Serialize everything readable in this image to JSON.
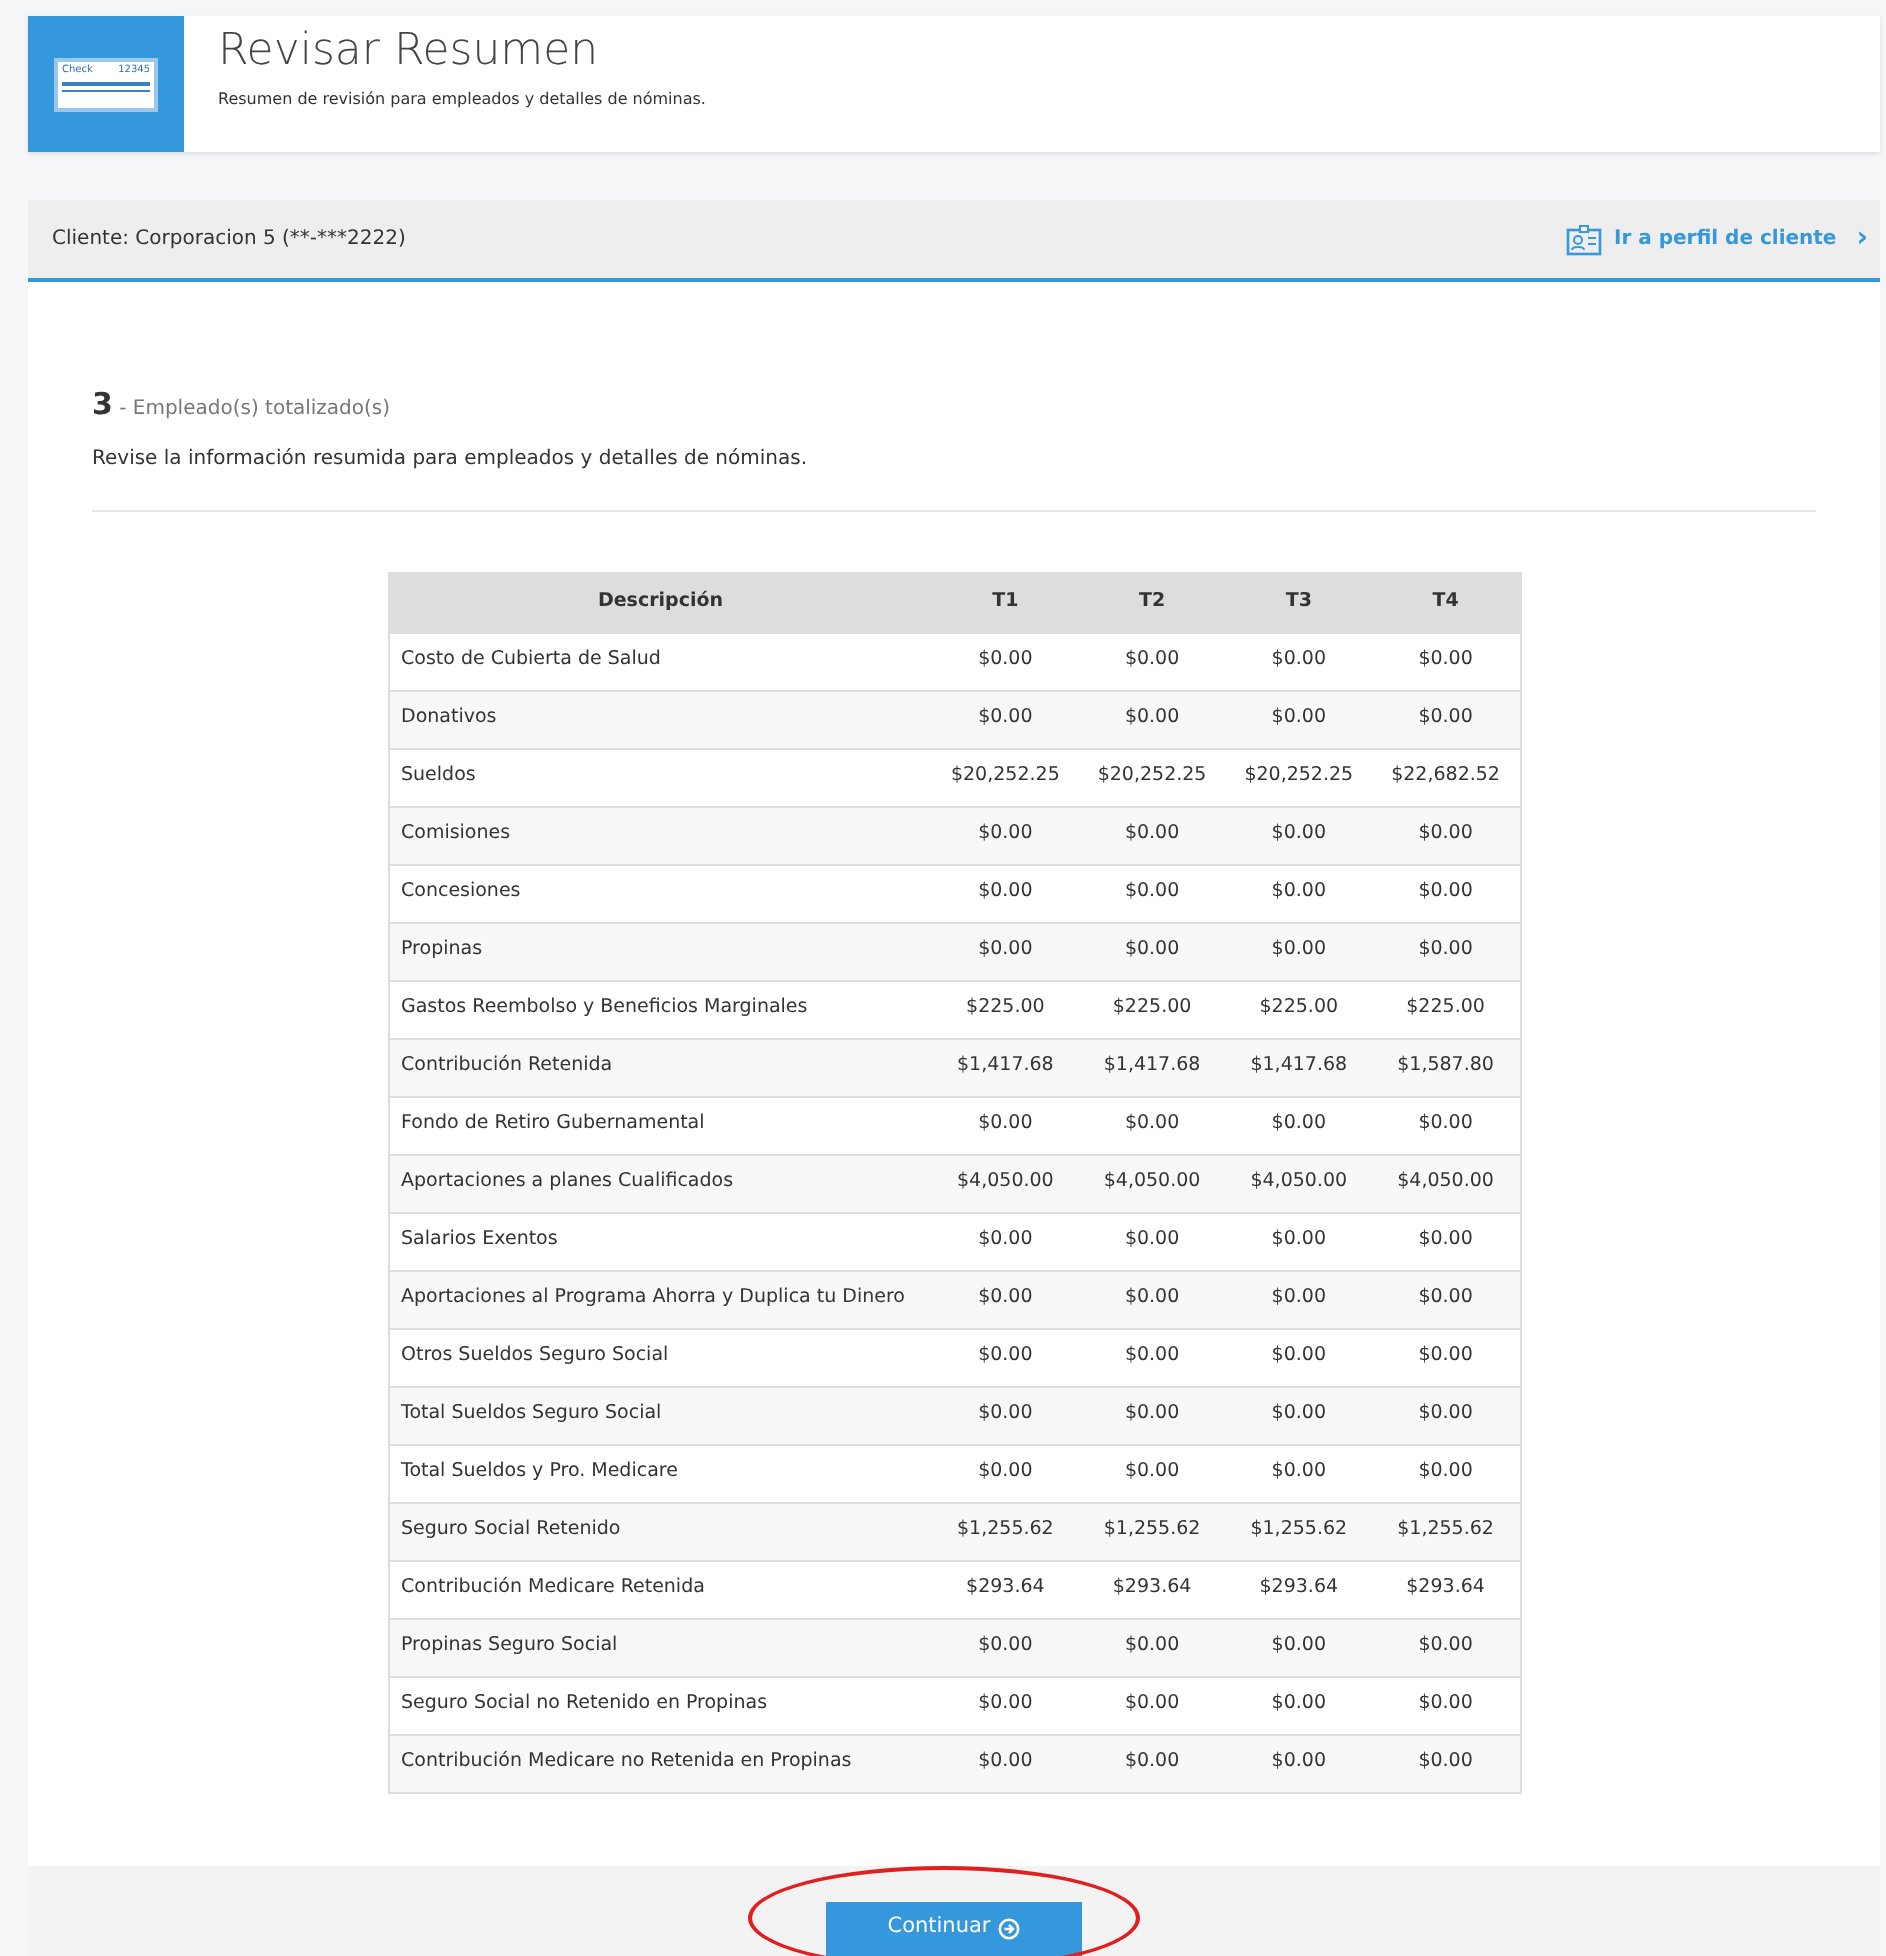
{
  "header": {
    "icon_text": [
      "Check",
      "12345"
    ],
    "title": "Revisar Resumen",
    "subtitle": "Resumen de revisión para empleados y detalles de nóminas."
  },
  "client_bar": {
    "client": "Cliente: Corporacion 5 (**-***2222)",
    "link": "Ir a perfil de cliente",
    "chevron": "›"
  },
  "summary": {
    "count": "3",
    "count_label": "- Empleado(s) totalizado(s)",
    "description": "Revise la información resumida para empleados y detalles de nóminas."
  },
  "table": {
    "columns": [
      "Descripción",
      "T1",
      "T2",
      "T3",
      "T4"
    ],
    "rows": [
      [
        "Costo de Cubierta de Salud",
        "$0.00",
        "$0.00",
        "$0.00",
        "$0.00"
      ],
      [
        "Donativos",
        "$0.00",
        "$0.00",
        "$0.00",
        "$0.00"
      ],
      [
        "Sueldos",
        "$20,252.25",
        "$20,252.25",
        "$20,252.25",
        "$22,682.52"
      ],
      [
        "Comisiones",
        "$0.00",
        "$0.00",
        "$0.00",
        "$0.00"
      ],
      [
        "Concesiones",
        "$0.00",
        "$0.00",
        "$0.00",
        "$0.00"
      ],
      [
        "Propinas",
        "$0.00",
        "$0.00",
        "$0.00",
        "$0.00"
      ],
      [
        "Gastos Reembolso y Beneficios Marginales",
        "$225.00",
        "$225.00",
        "$225.00",
        "$225.00"
      ],
      [
        "Contribución Retenida",
        "$1,417.68",
        "$1,417.68",
        "$1,417.68",
        "$1,587.80"
      ],
      [
        "Fondo de Retiro Gubernamental",
        "$0.00",
        "$0.00",
        "$0.00",
        "$0.00"
      ],
      [
        "Aportaciones a planes Cualificados",
        "$4,050.00",
        "$4,050.00",
        "$4,050.00",
        "$4,050.00"
      ],
      [
        "Salarios Exentos",
        "$0.00",
        "$0.00",
        "$0.00",
        "$0.00"
      ],
      [
        "Aportaciones al Programa Ahorra y Duplica tu Dinero",
        "$0.00",
        "$0.00",
        "$0.00",
        "$0.00"
      ],
      [
        "Otros Sueldos Seguro Social",
        "$0.00",
        "$0.00",
        "$0.00",
        "$0.00"
      ],
      [
        "Total Sueldos Seguro Social",
        "$0.00",
        "$0.00",
        "$0.00",
        "$0.00"
      ],
      [
        "Total Sueldos y Pro. Medicare",
        "$0.00",
        "$0.00",
        "$0.00",
        "$0.00"
      ],
      [
        "Seguro Social Retenido",
        "$1,255.62",
        "$1,255.62",
        "$1,255.62",
        "$1,255.62"
      ],
      [
        "Contribución Medicare Retenida",
        "$293.64",
        "$293.64",
        "$293.64",
        "$293.64"
      ],
      [
        "Propinas Seguro Social",
        "$0.00",
        "$0.00",
        "$0.00",
        "$0.00"
      ],
      [
        "Seguro Social no Retenido en Propinas",
        "$0.00",
        "$0.00",
        "$0.00",
        "$0.00"
      ],
      [
        "Contribución Medicare no Retenida en Propinas",
        "$0.00",
        "$0.00",
        "$0.00",
        "$0.00"
      ]
    ]
  },
  "footer": {
    "button": "Continuar",
    "highlighted": true
  }
}
